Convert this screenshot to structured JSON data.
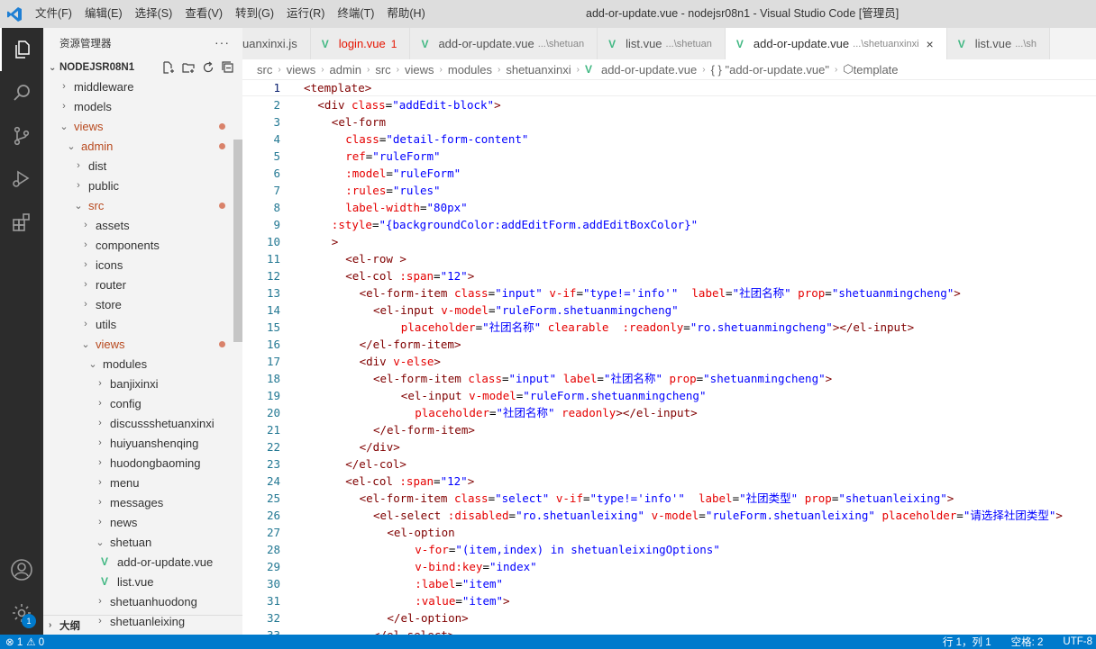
{
  "titlebar": {
    "menu": [
      "文件(F)",
      "编辑(E)",
      "选择(S)",
      "查看(V)",
      "转到(G)",
      "运行(R)",
      "终端(T)",
      "帮助(H)"
    ],
    "window_title": "add-or-update.vue - nodejsr08n1 - Visual Studio Code [管理员]"
  },
  "activitybar": {
    "items": [
      "explorer-icon",
      "search-icon",
      "source-control-icon",
      "run-debug-icon",
      "extensions-icon"
    ],
    "bottom": [
      "account-icon",
      "settings-gear-icon"
    ],
    "settings_badge": "1"
  },
  "sidebar": {
    "header": "资源管理器",
    "more": "···",
    "project": "NODEJSR08N1",
    "tree": [
      {
        "label": "middleware",
        "indent": 1,
        "twisty": "›",
        "modified": false
      },
      {
        "label": "models",
        "indent": 1,
        "twisty": "›",
        "modified": false
      },
      {
        "label": "views",
        "indent": 1,
        "twisty": "⌄",
        "modified": true
      },
      {
        "label": "admin",
        "indent": 2,
        "twisty": "⌄",
        "modified": true
      },
      {
        "label": "dist",
        "indent": 3,
        "twisty": "›",
        "modified": false
      },
      {
        "label": "public",
        "indent": 3,
        "twisty": "›",
        "modified": false
      },
      {
        "label": "src",
        "indent": 3,
        "twisty": "⌄",
        "modified": true
      },
      {
        "label": "assets",
        "indent": 4,
        "twisty": "›",
        "modified": false
      },
      {
        "label": "components",
        "indent": 4,
        "twisty": "›",
        "modified": false
      },
      {
        "label": "icons",
        "indent": 4,
        "twisty": "›",
        "modified": false
      },
      {
        "label": "router",
        "indent": 4,
        "twisty": "›",
        "modified": false
      },
      {
        "label": "store",
        "indent": 4,
        "twisty": "›",
        "modified": false
      },
      {
        "label": "utils",
        "indent": 4,
        "twisty": "›",
        "modified": false
      },
      {
        "label": "views",
        "indent": 4,
        "twisty": "⌄",
        "modified": true
      },
      {
        "label": "modules",
        "indent": 5,
        "twisty": "⌄",
        "modified": false
      },
      {
        "label": "banjixinxi",
        "indent": 6,
        "twisty": "›",
        "modified": false
      },
      {
        "label": "config",
        "indent": 6,
        "twisty": "›",
        "modified": false
      },
      {
        "label": "discussshetuanxinxi",
        "indent": 6,
        "twisty": "›",
        "modified": false
      },
      {
        "label": "huiyuanshenqing",
        "indent": 6,
        "twisty": "›",
        "modified": false
      },
      {
        "label": "huodongbaoming",
        "indent": 6,
        "twisty": "›",
        "modified": false
      },
      {
        "label": "menu",
        "indent": 6,
        "twisty": "›",
        "modified": false
      },
      {
        "label": "messages",
        "indent": 6,
        "twisty": "›",
        "modified": false
      },
      {
        "label": "news",
        "indent": 6,
        "twisty": "›",
        "modified": false
      },
      {
        "label": "shetuan",
        "indent": 6,
        "twisty": "⌄",
        "modified": false
      },
      {
        "label": "add-or-update.vue",
        "indent": 7,
        "twisty": "vue",
        "modified": false
      },
      {
        "label": "list.vue",
        "indent": 7,
        "twisty": "vue",
        "modified": false
      },
      {
        "label": "shetuanhuodong",
        "indent": 6,
        "twisty": "›",
        "modified": false
      },
      {
        "label": "shetuanleixing",
        "indent": 6,
        "twisty": "›",
        "modified": false
      }
    ],
    "outline": "大纲"
  },
  "tabs": [
    {
      "label": "uanxinxi.js",
      "desc": "",
      "vue": false,
      "active": false,
      "error": false
    },
    {
      "label": "login.vue",
      "desc": "",
      "vue": true,
      "active": false,
      "error": true,
      "err_count": "1"
    },
    {
      "label": "add-or-update.vue",
      "desc": "...\\shetuan",
      "vue": true,
      "active": false,
      "error": false
    },
    {
      "label": "list.vue",
      "desc": "...\\shetuan",
      "vue": true,
      "active": false,
      "error": false
    },
    {
      "label": "add-or-update.vue",
      "desc": "...\\shetuanxinxi",
      "vue": true,
      "active": true,
      "error": false,
      "close": "×"
    },
    {
      "label": "list.vue",
      "desc": "...\\sh",
      "vue": true,
      "active": false,
      "error": false
    }
  ],
  "breadcrumb": [
    "src",
    "views",
    "admin",
    "src",
    "views",
    "modules",
    "shetuanxinxi",
    "add-or-update.vue",
    "{ } \"add-or-update.vue\"",
    "template"
  ],
  "editor": {
    "lines": [
      [
        0,
        [
          [
            "t-tag",
            "<template>"
          ]
        ]
      ],
      [
        1,
        [
          [
            "t-tag",
            "<div "
          ],
          [
            "t-attr",
            "class"
          ],
          [
            "t-txt",
            "="
          ],
          [
            "t-str",
            "\"addEdit-block\""
          ],
          [
            "t-tag",
            ">"
          ]
        ]
      ],
      [
        2,
        [
          [
            "t-tag",
            "<el-form"
          ]
        ]
      ],
      [
        3,
        [
          [
            "t-attr",
            "class"
          ],
          [
            "t-txt",
            "="
          ],
          [
            "t-str",
            "\"detail-form-content\""
          ]
        ]
      ],
      [
        3,
        [
          [
            "t-attr",
            "ref"
          ],
          [
            "t-txt",
            "="
          ],
          [
            "t-str",
            "\"ruleForm\""
          ]
        ]
      ],
      [
        3,
        [
          [
            "t-attr",
            ":model"
          ],
          [
            "t-txt",
            "="
          ],
          [
            "t-str",
            "\"ruleForm\""
          ]
        ]
      ],
      [
        3,
        [
          [
            "t-attr",
            ":rules"
          ],
          [
            "t-txt",
            "="
          ],
          [
            "t-str",
            "\"rules\""
          ]
        ]
      ],
      [
        3,
        [
          [
            "t-attr",
            "label-width"
          ],
          [
            "t-txt",
            "="
          ],
          [
            "t-str",
            "\"80px\""
          ]
        ]
      ],
      [
        2,
        [
          [
            "t-attr",
            ":style"
          ],
          [
            "t-txt",
            "="
          ],
          [
            "t-str",
            "\"{backgroundColor:addEditForm.addEditBoxColor}\""
          ]
        ]
      ],
      [
        2,
        [
          [
            "t-tag",
            ">"
          ]
        ]
      ],
      [
        3,
        [
          [
            "t-tag",
            "<el-row >"
          ]
        ]
      ],
      [
        3,
        [
          [
            "t-tag",
            "<el-col "
          ],
          [
            "t-attr",
            ":span"
          ],
          [
            "t-txt",
            "="
          ],
          [
            "t-str",
            "\"12\""
          ],
          [
            "t-tag",
            ">"
          ]
        ]
      ],
      [
        4,
        [
          [
            "t-tag",
            "<el-form-item "
          ],
          [
            "t-attr",
            "class"
          ],
          [
            "t-txt",
            "="
          ],
          [
            "t-str",
            "\"input\""
          ],
          [
            "t-txt",
            " "
          ],
          [
            "t-attr",
            "v-if"
          ],
          [
            "t-txt",
            "="
          ],
          [
            "t-str",
            "\"type!='info'\""
          ],
          [
            "t-txt",
            "  "
          ],
          [
            "t-attr",
            "label"
          ],
          [
            "t-txt",
            "="
          ],
          [
            "t-str",
            "\"社团名称\""
          ],
          [
            "t-txt",
            " "
          ],
          [
            "t-attr",
            "prop"
          ],
          [
            "t-txt",
            "="
          ],
          [
            "t-str",
            "\"shetuanmingcheng\""
          ],
          [
            "t-tag",
            ">"
          ]
        ]
      ],
      [
        5,
        [
          [
            "t-tag",
            "<el-input "
          ],
          [
            "t-attr",
            "v-model"
          ],
          [
            "t-txt",
            "="
          ],
          [
            "t-str",
            "\"ruleForm.shetuanmingcheng\""
          ]
        ]
      ],
      [
        7,
        [
          [
            "t-attr",
            "placeholder"
          ],
          [
            "t-txt",
            "="
          ],
          [
            "t-str",
            "\"社团名称\""
          ],
          [
            "t-txt",
            " "
          ],
          [
            "t-attr",
            "clearable"
          ],
          [
            "t-txt",
            "  "
          ],
          [
            "t-attr",
            ":readonly"
          ],
          [
            "t-txt",
            "="
          ],
          [
            "t-str",
            "\"ro.shetuanmingcheng\""
          ],
          [
            "t-tag",
            "></el-input>"
          ]
        ]
      ],
      [
        4,
        [
          [
            "t-tag",
            "</el-form-item>"
          ]
        ]
      ],
      [
        4,
        [
          [
            "t-tag",
            "<div "
          ],
          [
            "t-attr",
            "v-else"
          ],
          [
            "t-tag",
            ">"
          ]
        ]
      ],
      [
        5,
        [
          [
            "t-tag",
            "<el-form-item "
          ],
          [
            "t-attr",
            "class"
          ],
          [
            "t-txt",
            "="
          ],
          [
            "t-str",
            "\"input\""
          ],
          [
            "t-txt",
            " "
          ],
          [
            "t-attr",
            "label"
          ],
          [
            "t-txt",
            "="
          ],
          [
            "t-str",
            "\"社团名称\""
          ],
          [
            "t-txt",
            " "
          ],
          [
            "t-attr",
            "prop"
          ],
          [
            "t-txt",
            "="
          ],
          [
            "t-str",
            "\"shetuanmingcheng\""
          ],
          [
            "t-tag",
            ">"
          ]
        ]
      ],
      [
        7,
        [
          [
            "t-tag",
            "<el-input "
          ],
          [
            "t-attr",
            "v-model"
          ],
          [
            "t-txt",
            "="
          ],
          [
            "t-str",
            "\"ruleForm.shetuanmingcheng\""
          ]
        ]
      ],
      [
        8,
        [
          [
            "t-attr",
            "placeholder"
          ],
          [
            "t-txt",
            "="
          ],
          [
            "t-str",
            "\"社团名称\""
          ],
          [
            "t-txt",
            " "
          ],
          [
            "t-attr",
            "readonly"
          ],
          [
            "t-tag",
            "></el-input>"
          ]
        ]
      ],
      [
        5,
        [
          [
            "t-tag",
            "</el-form-item>"
          ]
        ]
      ],
      [
        4,
        [
          [
            "t-tag",
            "</div>"
          ]
        ]
      ],
      [
        3,
        [
          [
            "t-tag",
            "</el-col>"
          ]
        ]
      ],
      [
        3,
        [
          [
            "t-tag",
            "<el-col "
          ],
          [
            "t-attr",
            ":span"
          ],
          [
            "t-txt",
            "="
          ],
          [
            "t-str",
            "\"12\""
          ],
          [
            "t-tag",
            ">"
          ]
        ]
      ],
      [
        4,
        [
          [
            "t-tag",
            "<el-form-item "
          ],
          [
            "t-attr",
            "class"
          ],
          [
            "t-txt",
            "="
          ],
          [
            "t-str",
            "\"select\""
          ],
          [
            "t-txt",
            " "
          ],
          [
            "t-attr",
            "v-if"
          ],
          [
            "t-txt",
            "="
          ],
          [
            "t-str",
            "\"type!='info'\""
          ],
          [
            "t-txt",
            "  "
          ],
          [
            "t-attr",
            "label"
          ],
          [
            "t-txt",
            "="
          ],
          [
            "t-str",
            "\"社团类型\""
          ],
          [
            "t-txt",
            " "
          ],
          [
            "t-attr",
            "prop"
          ],
          [
            "t-txt",
            "="
          ],
          [
            "t-str",
            "\"shetuanleixing\""
          ],
          [
            "t-tag",
            ">"
          ]
        ]
      ],
      [
        5,
        [
          [
            "t-tag",
            "<el-select "
          ],
          [
            "t-attr",
            ":disabled"
          ],
          [
            "t-txt",
            "="
          ],
          [
            "t-str",
            "\"ro.shetuanleixing\""
          ],
          [
            "t-txt",
            " "
          ],
          [
            "t-attr",
            "v-model"
          ],
          [
            "t-txt",
            "="
          ],
          [
            "t-str",
            "\"ruleForm.shetuanleixing\""
          ],
          [
            "t-txt",
            " "
          ],
          [
            "t-attr",
            "placeholder"
          ],
          [
            "t-txt",
            "="
          ],
          [
            "t-str",
            "\"请选择社团类型\""
          ],
          [
            "t-tag",
            ">"
          ]
        ]
      ],
      [
        6,
        [
          [
            "t-tag",
            "<el-option"
          ]
        ]
      ],
      [
        8,
        [
          [
            "t-attr",
            "v-for"
          ],
          [
            "t-txt",
            "="
          ],
          [
            "t-str",
            "\"(item,index) in shetuanleixingOptions\""
          ]
        ]
      ],
      [
        8,
        [
          [
            "t-attr",
            "v-bind:key"
          ],
          [
            "t-txt",
            "="
          ],
          [
            "t-str",
            "\"index\""
          ]
        ]
      ],
      [
        8,
        [
          [
            "t-attr",
            ":label"
          ],
          [
            "t-txt",
            "="
          ],
          [
            "t-str",
            "\"item\""
          ]
        ]
      ],
      [
        8,
        [
          [
            "t-attr",
            ":value"
          ],
          [
            "t-txt",
            "="
          ],
          [
            "t-str",
            "\"item\""
          ],
          [
            "t-tag",
            ">"
          ]
        ]
      ],
      [
        6,
        [
          [
            "t-tag",
            "</el-option>"
          ]
        ]
      ],
      [
        5,
        [
          [
            "t-tag",
            "</el-select>"
          ]
        ]
      ]
    ]
  },
  "statusbar": {
    "errors": "⊗ 1",
    "warnings": "⚠ 0",
    "position": "行 1，列 1",
    "spaces": "空格: 2",
    "encoding": "UTF-8"
  }
}
